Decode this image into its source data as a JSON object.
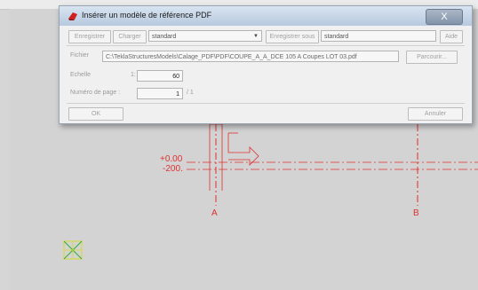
{
  "dialog": {
    "title": "Insérer un modèle de référence PDF",
    "close_symbol": "X",
    "toolbar": {
      "save_label": "Enregistrer",
      "load_label": "Charger",
      "preset_value": "standard",
      "save_as_label": "Enregistrer sous",
      "save_as_value": "standard",
      "help_label": "Aide"
    },
    "file_label": "Fichier",
    "file_path": "C:\\TeklaStructuresModels\\Calage_PDF\\PDF\\COUPE_A_A_DCE 105 A Coupes LOT 03.pdf",
    "browse_label": "Parcourir...",
    "scale_label": "Echelle",
    "scale_ratio_left": "1:",
    "scale_value": "60",
    "page_label": "Numéro de page :",
    "page_value": "1",
    "page_total": "/ 1",
    "ok_label": "OK",
    "cancel_label": "Annuler"
  },
  "drawing": {
    "elevation_top": "+0.00",
    "elevation_bottom": "-200.",
    "axis_a": "A",
    "axis_b": "B"
  },
  "colors": {
    "drawing_red": "#e03030",
    "marker_yellow": "#d8d830",
    "marker_green": "#30b030"
  }
}
